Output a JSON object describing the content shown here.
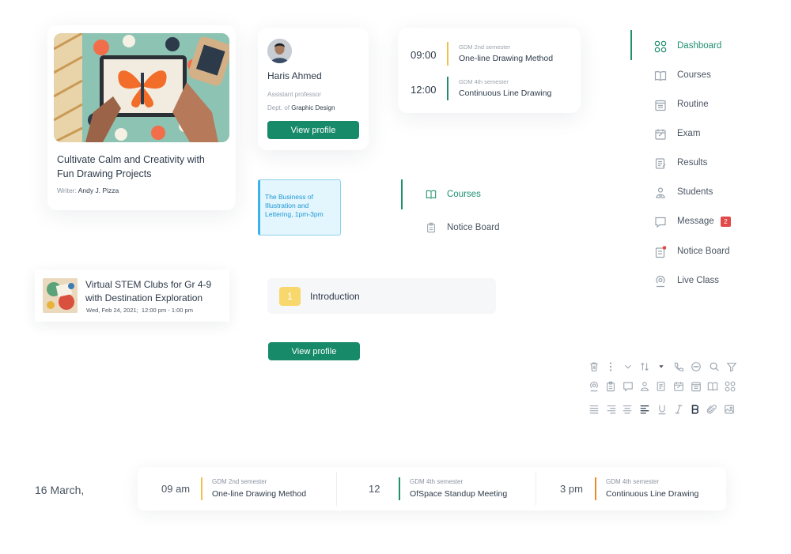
{
  "colors": {
    "accent": "#1f8f6e",
    "yellow": "#f0c24b",
    "orange": "#ee8a2c",
    "badge": "#e24a4a",
    "event": "#3cb3e8"
  },
  "blog": {
    "title": "Cultivate Calm and Creativity with Fun Drawing Projects",
    "writer_prefix": "Writer: ",
    "writer": "Andy J. Pizza"
  },
  "profile": {
    "name": "Haris Ahmed",
    "role": "Assistant professor",
    "dept_prefix": "Dept. of ",
    "dept": "Graphic Design",
    "button": "View profile"
  },
  "schedule": [
    {
      "time": "09:00",
      "sub": "GDM 2nd semester",
      "title": "One-line Drawing Method",
      "color": "#f0c24b"
    },
    {
      "time": "12:00",
      "sub": "GDM 4th semester",
      "title": "Continuous Line Drawing",
      "color": "#1f8f6e"
    }
  ],
  "event": {
    "text": "The Business of Illustration and Lettering, 1pm-3pm"
  },
  "mini_menu": [
    {
      "label": "Courses",
      "icon": "book-icon",
      "active": true
    },
    {
      "label": "Notice Board",
      "icon": "clipboard-icon",
      "active": false
    }
  ],
  "sidebar": {
    "items": [
      {
        "label": "Dashboard",
        "icon": "grid-icon",
        "active": true
      },
      {
        "label": "Courses",
        "icon": "book-icon"
      },
      {
        "label": "Routine",
        "icon": "calendar-list-icon"
      },
      {
        "label": "Exam",
        "icon": "exam-calendar-icon"
      },
      {
        "label": "Results",
        "icon": "results-icon"
      },
      {
        "label": "Students",
        "icon": "students-icon"
      },
      {
        "label": "Message",
        "icon": "message-icon",
        "badge": "2"
      },
      {
        "label": "Notice Board",
        "icon": "notice-board-icon"
      },
      {
        "label": "Live Class",
        "icon": "live-class-icon"
      }
    ]
  },
  "stem": {
    "title": "Virtual STEM Clubs for Gr 4-9 with Destination Exploration",
    "date": "Wed, Feb 24, 2021;",
    "time": "12:00 pm - 1:00 pm"
  },
  "intro": {
    "number": "1",
    "label": "Introduction"
  },
  "second_button": "View profile",
  "timeline": {
    "date": "16 March,",
    "items": [
      {
        "time": "09 am",
        "sub": "GDM 2nd semester",
        "title": "One-line Drawing Method",
        "color": "#f0c24b"
      },
      {
        "time": "12",
        "sub": "GDM 4th semester",
        "title": "OfSpace Standup Meeting",
        "color": "#1f8f6e"
      },
      {
        "time": "3 pm",
        "sub": "GDM 4th semester",
        "title": "Continuous Line Drawing",
        "color": "#ee8a2c"
      }
    ]
  },
  "toolbar_icons": [
    [
      "trash-icon",
      "more-vertical-icon",
      "chevron-down-icon",
      "sort-icon",
      "caret-down-icon",
      "phone-icon",
      "chat-dots-icon",
      "search-icon",
      "filter-icon"
    ],
    [
      "live-class-icon",
      "notice-board-icon",
      "message-icon",
      "students-icon",
      "results-icon",
      "exam-calendar-icon",
      "calendar-list-icon",
      "book-icon",
      "grid-icon"
    ],
    [
      "align-justify-icon",
      "align-right-icon",
      "align-center-icon",
      "align-left-icon",
      "underline-icon",
      "italic-icon",
      "bold-icon",
      "paperclip-icon",
      "image-icon"
    ]
  ]
}
